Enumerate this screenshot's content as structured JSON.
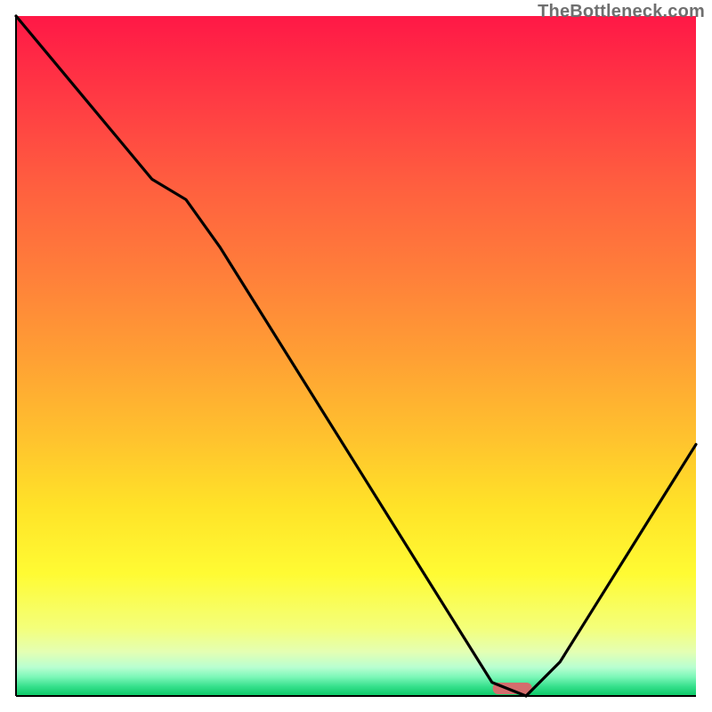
{
  "watermark": {
    "text": "TheBottleneck.com"
  },
  "marker": {
    "color": "#d46d6d"
  },
  "gradient_stops": [
    {
      "offset": 0.0,
      "color": "#ff1846"
    },
    {
      "offset": 0.12,
      "color": "#ff3a44"
    },
    {
      "offset": 0.25,
      "color": "#ff5f3f"
    },
    {
      "offset": 0.38,
      "color": "#ff7f3a"
    },
    {
      "offset": 0.5,
      "color": "#ff9f34"
    },
    {
      "offset": 0.62,
      "color": "#ffc22e"
    },
    {
      "offset": 0.72,
      "color": "#ffe228"
    },
    {
      "offset": 0.82,
      "color": "#fffb33"
    },
    {
      "offset": 0.9,
      "color": "#f4ff7a"
    },
    {
      "offset": 0.935,
      "color": "#e4ffb3"
    },
    {
      "offset": 0.958,
      "color": "#b8ffd1"
    },
    {
      "offset": 0.972,
      "color": "#7cf7b8"
    },
    {
      "offset": 0.986,
      "color": "#36e08c"
    },
    {
      "offset": 1.0,
      "color": "#0ac765"
    }
  ],
  "chart_data": {
    "type": "line",
    "title": "",
    "xlabel": "",
    "ylabel": "",
    "xlim": [
      0,
      100
    ],
    "ylim": [
      0,
      100
    ],
    "marker_x": 73,
    "x": [
      0,
      5,
      10,
      15,
      20,
      25,
      30,
      35,
      40,
      45,
      50,
      55,
      60,
      65,
      70,
      75,
      80,
      85,
      90,
      95,
      100
    ],
    "values": [
      100,
      94,
      88,
      82,
      76,
      73,
      66,
      58,
      50,
      42,
      34,
      26,
      18,
      10,
      2,
      0,
      5,
      13,
      21,
      29,
      37
    ]
  }
}
